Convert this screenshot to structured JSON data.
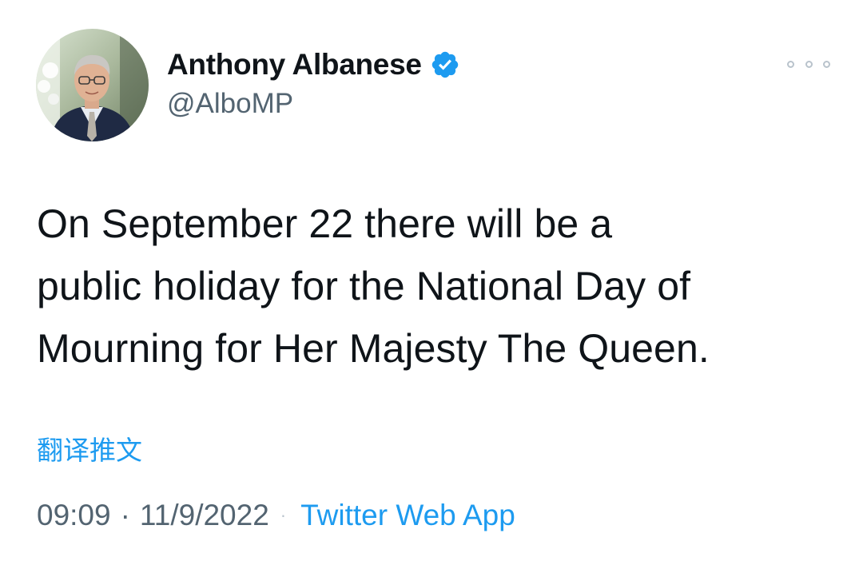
{
  "author": {
    "display_name": "Anthony Albanese",
    "handle": "@AlboMP",
    "verified": true,
    "avatar": "profile-photo"
  },
  "tweet": {
    "lines": [
      "On September 22 there will be a",
      "public holiday for the National Day of",
      "Mourning for Her Majesty The Queen."
    ],
    "translate_label": "翻译推文"
  },
  "meta": {
    "time": "09:09",
    "separator": "·",
    "date": "11/9/2022",
    "source": "Twitter Web App"
  },
  "icons": {
    "verified": "verified-badge-icon",
    "more": "more-options-icon"
  },
  "colors": {
    "accent": "#1d9bf0",
    "text": "#0f1419",
    "secondary": "#536471"
  }
}
